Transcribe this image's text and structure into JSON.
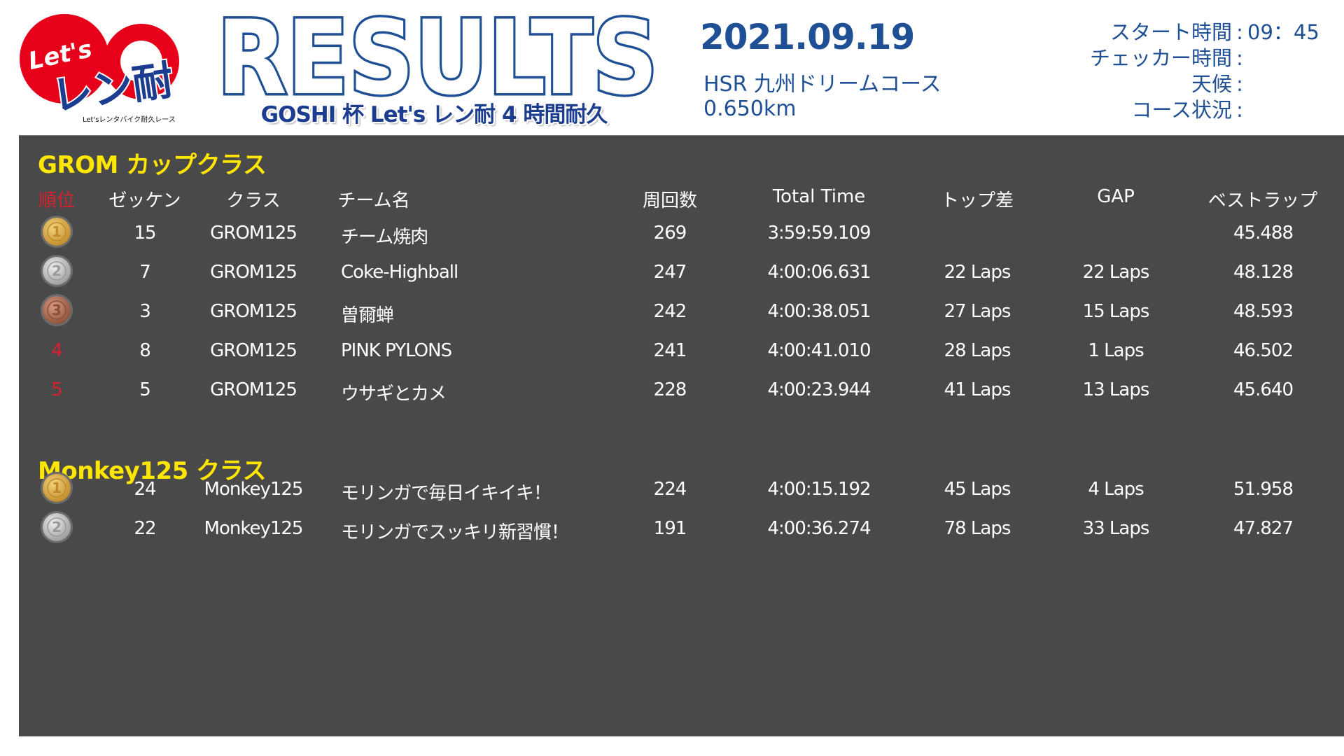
{
  "header": {
    "logo_top": "Let's",
    "logo_main": "レン耐",
    "logo_sub": "Let'sレンタバイク耐久レース",
    "title": "RESULTS",
    "subtitle": "GOSHI 杯 Let's レン耐 4 時間耐久",
    "date": "2021.09.19",
    "venue": "HSR 九州ドリームコース",
    "length": "0.650km"
  },
  "info": [
    {
      "label": "スタート時間",
      "value": "09：45"
    },
    {
      "label": "チェッカー時間",
      "value": ""
    },
    {
      "label": "天候",
      "value": ""
    },
    {
      "label": "コース状況",
      "value": ""
    }
  ],
  "info_colon": ":",
  "columns": {
    "rank": "順位",
    "number": "ゼッケン",
    "class": "クラス",
    "team": "チーム名",
    "laps": "周回数",
    "total_time": "Total Time",
    "top_diff": "トップ差",
    "gap": "GAP",
    "best_lap": "ベストラップ"
  },
  "colors": {
    "board": "#494949",
    "class_title": "#ffe600",
    "rank_red": "#d8212f",
    "header_blue": "#1f4f95",
    "gold": "#d9a441",
    "silver": "#bdbdbd",
    "bronze": "#b0735a"
  },
  "classes": [
    {
      "title": "GROM カップクラス",
      "rows": [
        {
          "rank": "1",
          "medal": "gold",
          "number": "15",
          "class": "GROM125",
          "team": "チーム焼肉",
          "laps": "269",
          "total_time": "3:59:59.109",
          "top_diff": "",
          "gap": "",
          "best_lap": "45.488"
        },
        {
          "rank": "2",
          "medal": "silver",
          "number": "7",
          "class": "GROM125",
          "team": "Coke-Highball",
          "laps": "247",
          "total_time": "4:00:06.631",
          "top_diff": "22 Laps",
          "gap": "22 Laps",
          "best_lap": "48.128"
        },
        {
          "rank": "3",
          "medal": "bronze",
          "number": "3",
          "class": "GROM125",
          "team": "曽爾蝉",
          "laps": "242",
          "total_time": "4:00:38.051",
          "top_diff": "27 Laps",
          "gap": "15 Laps",
          "best_lap": "48.593"
        },
        {
          "rank": "4",
          "medal": "",
          "number": "8",
          "class": "GROM125",
          "team": "PINK PYLONS",
          "laps": "241",
          "total_time": "4:00:41.010",
          "top_diff": "28 Laps",
          "gap": "1 Laps",
          "best_lap": "46.502"
        },
        {
          "rank": "5",
          "medal": "",
          "number": "5",
          "class": "GROM125",
          "team": "ウサギとカメ",
          "laps": "228",
          "total_time": "4:00:23.944",
          "top_diff": "41 Laps",
          "gap": "13 Laps",
          "best_lap": "45.640"
        }
      ]
    },
    {
      "title": "Monkey125 クラス",
      "rows": [
        {
          "rank": "1",
          "medal": "gold",
          "number": "24",
          "class": "Monkey125",
          "team": "モリンガで毎日イキイキ！",
          "laps": "224",
          "total_time": "4:00:15.192",
          "top_diff": "45 Laps",
          "gap": "4 Laps",
          "best_lap": "51.958"
        },
        {
          "rank": "2",
          "medal": "silver",
          "number": "22",
          "class": "Monkey125",
          "team": "モリンガでスッキリ新習慣！",
          "laps": "191",
          "total_time": "4:00:36.274",
          "top_diff": "78 Laps",
          "gap": "33 Laps",
          "best_lap": "47.827"
        }
      ]
    }
  ]
}
